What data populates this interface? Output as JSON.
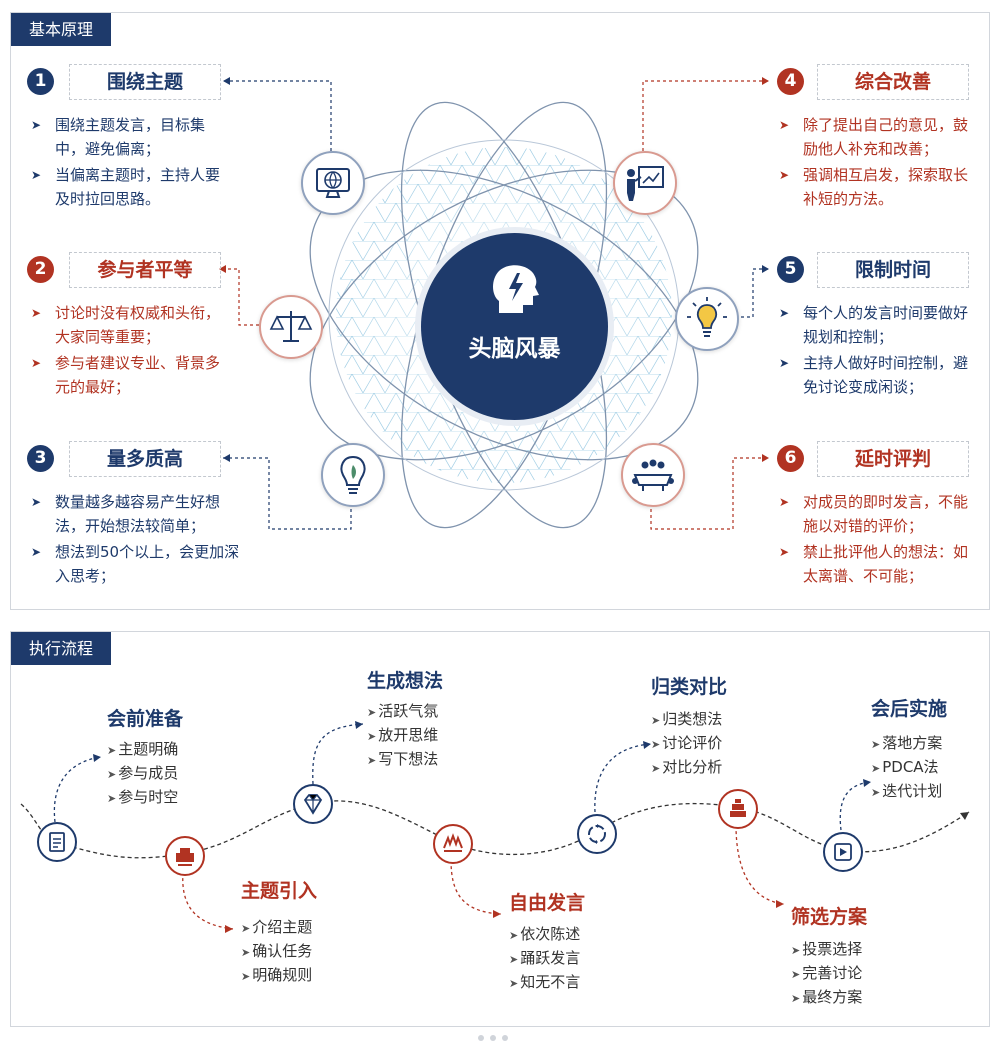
{
  "section_principles": {
    "tab_label": "基本原理",
    "center_label": "头脑风暴",
    "principles": [
      {
        "number": "1",
        "title": "围绕主题",
        "color": "#1e3a6b",
        "icon": "globe-monitor-icon",
        "bullets": [
          "围绕主题发言，目标集中，避免偏离；",
          "当偏离主题时，主持人要及时拉回思路。"
        ]
      },
      {
        "number": "2",
        "title": "参与者平等",
        "color": "#b13322",
        "icon": "balance-scale-icon",
        "bullets": [
          "讨论时没有权威和头衔，大家同等重要；",
          "参与者建议专业、背景多元的最好；"
        ]
      },
      {
        "number": "3",
        "title": "量多质高",
        "color": "#1e3a6b",
        "icon": "idea-bulb-icon",
        "bullets": [
          "数量越多越容易产生好想法，开始想法较简单；",
          "想法到50个以上，会更加深入思考；"
        ]
      },
      {
        "number": "4",
        "title": "综合改善",
        "color": "#b13322",
        "icon": "presentation-board-icon",
        "bullets": [
          "除了提出自己的意见，鼓励他人补充和改善；",
          "强调相互启发，探索取长补短的方法。"
        ]
      },
      {
        "number": "5",
        "title": "限制时间",
        "color": "#1e3a6b",
        "icon": "light-bulb-icon",
        "bullets": [
          "每个人的发言时间要做好规划和控制；",
          "主持人做好时间控制，避免讨论变成闲谈；"
        ]
      },
      {
        "number": "6",
        "title": "延时评判",
        "color": "#b13322",
        "icon": "meeting-table-icon",
        "bullets": [
          "对成员的即时发言，不能施以对错的评价；",
          "禁止批评他人的想法：如太离谱、不可能；"
        ]
      }
    ]
  },
  "section_process": {
    "tab_label": "执行流程",
    "steps": [
      {
        "title": "会前准备",
        "color": "#1e3a6b",
        "icon": "checklist-icon",
        "items": [
          "主题明确",
          "参与成员",
          "参与时空"
        ]
      },
      {
        "title": "主题引入",
        "color": "#b13322",
        "icon": "projector-icon",
        "items": [
          "介绍主题",
          "确认任务",
          "明确规则"
        ]
      },
      {
        "title": "生成想法",
        "color": "#1e3a6b",
        "icon": "diamond-icon",
        "items": [
          "活跃气氛",
          "放开思维",
          "写下想法"
        ]
      },
      {
        "title": "自由发言",
        "color": "#b13322",
        "icon": "speaking-hands-icon",
        "items": [
          "依次陈述",
          "踊跃发言",
          "知无不言"
        ]
      },
      {
        "title": "归类对比",
        "color": "#1e3a6b",
        "icon": "cycle-gear-icon",
        "items": [
          "归类想法",
          "讨论评价",
          "对比分析"
        ]
      },
      {
        "title": "筛选方案",
        "color": "#b13322",
        "icon": "filter-stack-icon",
        "items": [
          "投票选择",
          "完善讨论",
          "最终方案"
        ]
      },
      {
        "title": "会后实施",
        "color": "#1e3a6b",
        "icon": "play-button-icon",
        "items": [
          "落地方案",
          "PDCA法",
          "迭代计划"
        ]
      }
    ]
  }
}
